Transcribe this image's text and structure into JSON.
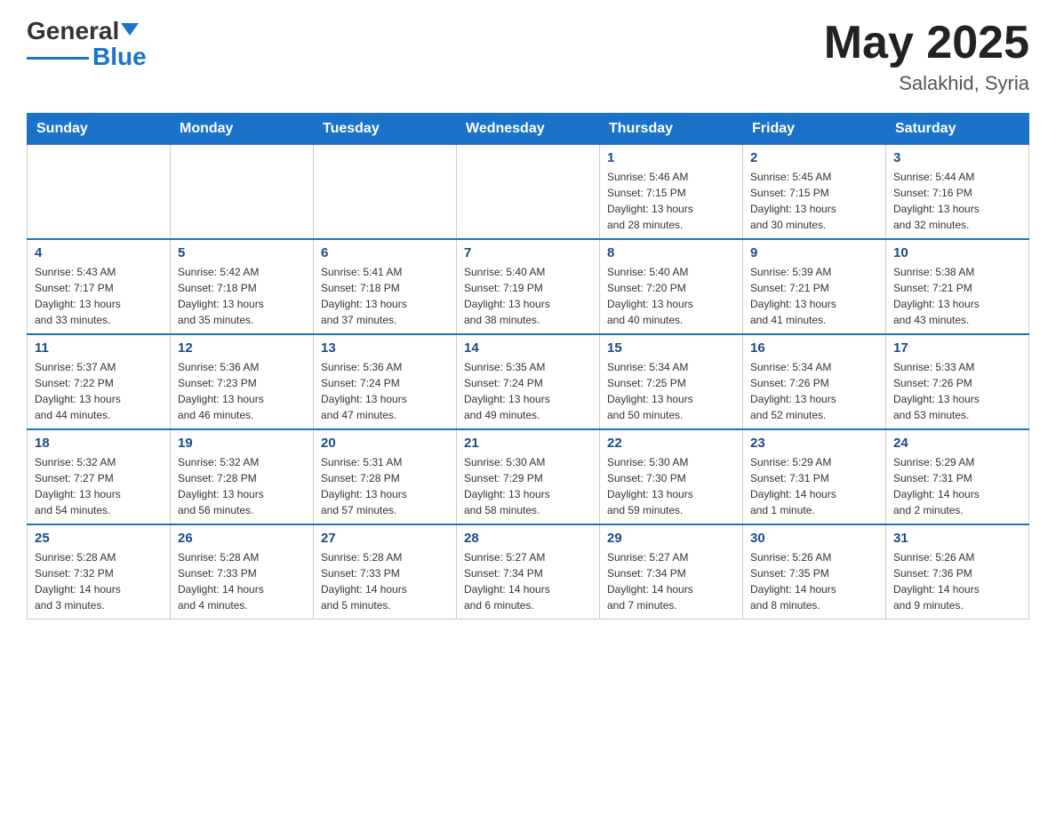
{
  "header": {
    "logo_line1": "General",
    "logo_line2": "Blue",
    "month": "May 2025",
    "location": "Salakhid, Syria"
  },
  "weekdays": [
    "Sunday",
    "Monday",
    "Tuesday",
    "Wednesday",
    "Thursday",
    "Friday",
    "Saturday"
  ],
  "weeks": [
    [
      {
        "day": "",
        "info": ""
      },
      {
        "day": "",
        "info": ""
      },
      {
        "day": "",
        "info": ""
      },
      {
        "day": "",
        "info": ""
      },
      {
        "day": "1",
        "info": "Sunrise: 5:46 AM\nSunset: 7:15 PM\nDaylight: 13 hours\nand 28 minutes."
      },
      {
        "day": "2",
        "info": "Sunrise: 5:45 AM\nSunset: 7:15 PM\nDaylight: 13 hours\nand 30 minutes."
      },
      {
        "day": "3",
        "info": "Sunrise: 5:44 AM\nSunset: 7:16 PM\nDaylight: 13 hours\nand 32 minutes."
      }
    ],
    [
      {
        "day": "4",
        "info": "Sunrise: 5:43 AM\nSunset: 7:17 PM\nDaylight: 13 hours\nand 33 minutes."
      },
      {
        "day": "5",
        "info": "Sunrise: 5:42 AM\nSunset: 7:18 PM\nDaylight: 13 hours\nand 35 minutes."
      },
      {
        "day": "6",
        "info": "Sunrise: 5:41 AM\nSunset: 7:18 PM\nDaylight: 13 hours\nand 37 minutes."
      },
      {
        "day": "7",
        "info": "Sunrise: 5:40 AM\nSunset: 7:19 PM\nDaylight: 13 hours\nand 38 minutes."
      },
      {
        "day": "8",
        "info": "Sunrise: 5:40 AM\nSunset: 7:20 PM\nDaylight: 13 hours\nand 40 minutes."
      },
      {
        "day": "9",
        "info": "Sunrise: 5:39 AM\nSunset: 7:21 PM\nDaylight: 13 hours\nand 41 minutes."
      },
      {
        "day": "10",
        "info": "Sunrise: 5:38 AM\nSunset: 7:21 PM\nDaylight: 13 hours\nand 43 minutes."
      }
    ],
    [
      {
        "day": "11",
        "info": "Sunrise: 5:37 AM\nSunset: 7:22 PM\nDaylight: 13 hours\nand 44 minutes."
      },
      {
        "day": "12",
        "info": "Sunrise: 5:36 AM\nSunset: 7:23 PM\nDaylight: 13 hours\nand 46 minutes."
      },
      {
        "day": "13",
        "info": "Sunrise: 5:36 AM\nSunset: 7:24 PM\nDaylight: 13 hours\nand 47 minutes."
      },
      {
        "day": "14",
        "info": "Sunrise: 5:35 AM\nSunset: 7:24 PM\nDaylight: 13 hours\nand 49 minutes."
      },
      {
        "day": "15",
        "info": "Sunrise: 5:34 AM\nSunset: 7:25 PM\nDaylight: 13 hours\nand 50 minutes."
      },
      {
        "day": "16",
        "info": "Sunrise: 5:34 AM\nSunset: 7:26 PM\nDaylight: 13 hours\nand 52 minutes."
      },
      {
        "day": "17",
        "info": "Sunrise: 5:33 AM\nSunset: 7:26 PM\nDaylight: 13 hours\nand 53 minutes."
      }
    ],
    [
      {
        "day": "18",
        "info": "Sunrise: 5:32 AM\nSunset: 7:27 PM\nDaylight: 13 hours\nand 54 minutes."
      },
      {
        "day": "19",
        "info": "Sunrise: 5:32 AM\nSunset: 7:28 PM\nDaylight: 13 hours\nand 56 minutes."
      },
      {
        "day": "20",
        "info": "Sunrise: 5:31 AM\nSunset: 7:28 PM\nDaylight: 13 hours\nand 57 minutes."
      },
      {
        "day": "21",
        "info": "Sunrise: 5:30 AM\nSunset: 7:29 PM\nDaylight: 13 hours\nand 58 minutes."
      },
      {
        "day": "22",
        "info": "Sunrise: 5:30 AM\nSunset: 7:30 PM\nDaylight: 13 hours\nand 59 minutes."
      },
      {
        "day": "23",
        "info": "Sunrise: 5:29 AM\nSunset: 7:31 PM\nDaylight: 14 hours\nand 1 minute."
      },
      {
        "day": "24",
        "info": "Sunrise: 5:29 AM\nSunset: 7:31 PM\nDaylight: 14 hours\nand 2 minutes."
      }
    ],
    [
      {
        "day": "25",
        "info": "Sunrise: 5:28 AM\nSunset: 7:32 PM\nDaylight: 14 hours\nand 3 minutes."
      },
      {
        "day": "26",
        "info": "Sunrise: 5:28 AM\nSunset: 7:33 PM\nDaylight: 14 hours\nand 4 minutes."
      },
      {
        "day": "27",
        "info": "Sunrise: 5:28 AM\nSunset: 7:33 PM\nDaylight: 14 hours\nand 5 minutes."
      },
      {
        "day": "28",
        "info": "Sunrise: 5:27 AM\nSunset: 7:34 PM\nDaylight: 14 hours\nand 6 minutes."
      },
      {
        "day": "29",
        "info": "Sunrise: 5:27 AM\nSunset: 7:34 PM\nDaylight: 14 hours\nand 7 minutes."
      },
      {
        "day": "30",
        "info": "Sunrise: 5:26 AM\nSunset: 7:35 PM\nDaylight: 14 hours\nand 8 minutes."
      },
      {
        "day": "31",
        "info": "Sunrise: 5:26 AM\nSunset: 7:36 PM\nDaylight: 14 hours\nand 9 minutes."
      }
    ]
  ]
}
